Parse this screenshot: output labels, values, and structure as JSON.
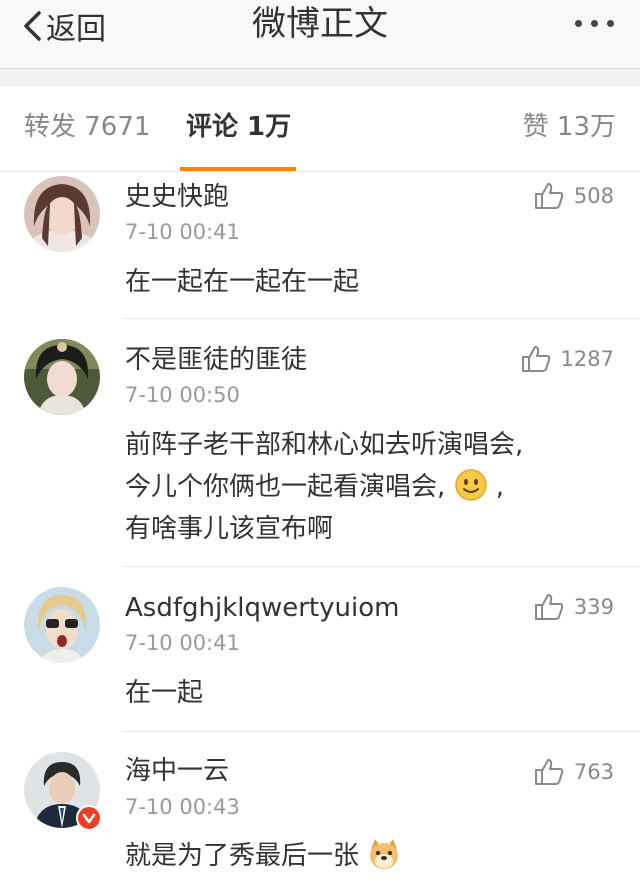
{
  "nav": {
    "back_label": "返回",
    "title": "微博正文"
  },
  "tabs": {
    "repost": "转发 7671",
    "comments": "评论 1万",
    "likes": "赞 13万",
    "active": "comments",
    "accent": "#ff8200"
  },
  "comments": [
    {
      "name": "史史快跑",
      "time": "7-10 00:41",
      "likes": "508",
      "lines": [
        "在一起在一起在一起"
      ]
    },
    {
      "name": "不是匪徒的匪徒",
      "time": "7-10 00:50",
      "likes": "1287",
      "lines": [
        "前阵子老干部和林心如去听演唱会,",
        "今儿个你俩也一起看演唱会,",
        "有啥事儿该宣布啊"
      ],
      "emoji_after_line_2": "smile-emoji",
      "line2_tail": ","
    },
    {
      "name": "Asdfghjklqwertyuiom",
      "time": "7-10 00:41",
      "likes": "339",
      "lines": [
        "在一起"
      ]
    },
    {
      "name": "海中一云",
      "time": "7-10 00:43",
      "likes": "763",
      "lines": [
        "就是为了秀最后一张"
      ],
      "emoji_after_line_1": "doge-emoji",
      "verified_badge": "red-v-badge"
    }
  ]
}
